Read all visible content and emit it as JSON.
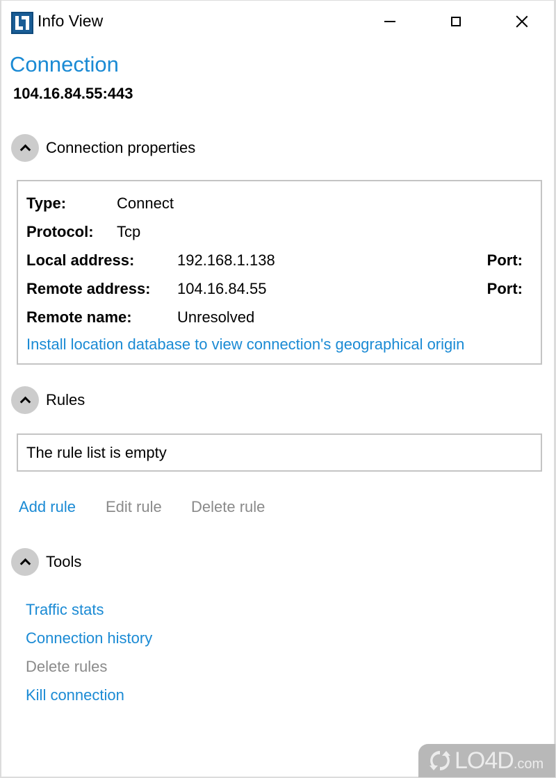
{
  "window": {
    "title": "Info View",
    "app_icon": "app-logo-icon",
    "controls": {
      "minimize": "minimize-icon",
      "maximize": "maximize-icon",
      "close": "close-icon"
    }
  },
  "header": {
    "heading": "Connection",
    "address": "104.16.84.55:443"
  },
  "sections": {
    "properties": {
      "title": "Connection properties",
      "expanded": true,
      "rows": [
        {
          "label": "Type:",
          "value": "Connect"
        },
        {
          "label": "Protocol:",
          "value": "Tcp"
        },
        {
          "label": "Local address:",
          "value": "192.168.1.138",
          "port_label": "Port:"
        },
        {
          "label": "Remote address:",
          "value": "104.16.84.55",
          "port_label": "Port:"
        },
        {
          "label": "Remote name:",
          "value": "Unresolved"
        }
      ],
      "geo_link": "Install location database to view connection's geographical origin"
    },
    "rules": {
      "title": "Rules",
      "expanded": true,
      "empty_text": "The rule list is empty",
      "actions": [
        {
          "label": "Add rule",
          "enabled": true
        },
        {
          "label": "Edit rule",
          "enabled": false
        },
        {
          "label": "Delete rule",
          "enabled": false
        }
      ]
    },
    "tools": {
      "title": "Tools",
      "expanded": true,
      "items": [
        {
          "label": "Traffic stats",
          "enabled": true
        },
        {
          "label": "Connection history",
          "enabled": true
        },
        {
          "label": "Delete rules",
          "enabled": false
        },
        {
          "label": "Kill connection",
          "enabled": true
        }
      ]
    }
  },
  "watermark": {
    "brand": "LO4D",
    "suffix": ".com"
  },
  "colors": {
    "accent": "#1a8ad4",
    "disabled": "#8a8a8a",
    "app_icon": "#1a5d96",
    "collapse_button": "#cccccc"
  }
}
